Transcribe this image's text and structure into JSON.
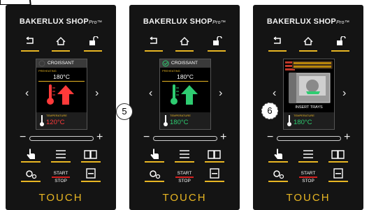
{
  "brand": {
    "name": "BAKERLUX SHOP",
    "suffix": "Pro",
    "tm": "™"
  },
  "panels": [
    {
      "product": "CROISSANT",
      "phase": "PREHEATING",
      "set_temp": "180°C",
      "temp_label": "TEMPERATURE",
      "current_temp": "120°C",
      "current_temp_color": "#ff3a3a",
      "thermo_color": "#ff3a3a",
      "arrow_color": "#ff3a3a",
      "callout": ""
    },
    {
      "product": "CROISSANT",
      "phase": "PREHEATING",
      "set_temp": "180°C",
      "temp_label": "TEMPERATURE",
      "current_temp": "180°C",
      "current_temp_color": "#2ecc71",
      "thermo_color": "#2ecc71",
      "arrow_color": "#2ecc71",
      "callout": "5"
    },
    {
      "product": "INSERT TRAYS",
      "temp_label": "TEMPERATURE",
      "current_temp": "180°C",
      "current_temp_color": "#2ecc71",
      "callout": "6"
    }
  ],
  "controls": {
    "start": "START",
    "stop": "STOP",
    "minus": "−",
    "plus": "+",
    "left": "‹",
    "right": "›"
  },
  "footer": {
    "touch": "TOUCH"
  }
}
